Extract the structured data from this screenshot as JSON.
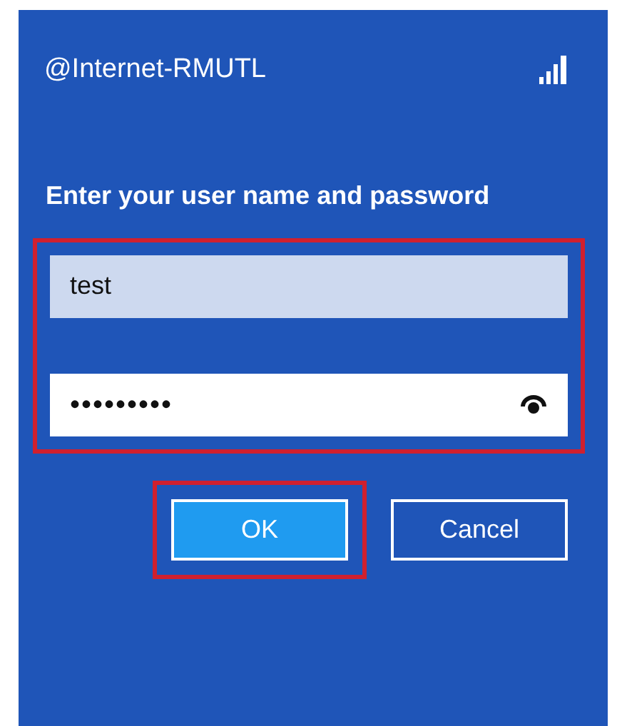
{
  "network_name": "@Internet-RMUTL",
  "prompt": "Enter your user name and password",
  "fields": {
    "highlighted": true,
    "items": [
      {
        "kind": "username",
        "value": "test"
      },
      {
        "kind": "password",
        "value": "•••••••••"
      }
    ]
  },
  "buttons": [
    {
      "label": "OK",
      "kind": "primary",
      "highlighted": true
    },
    {
      "label": "Cancel",
      "kind": "secondary",
      "highlighted": false
    }
  ]
}
